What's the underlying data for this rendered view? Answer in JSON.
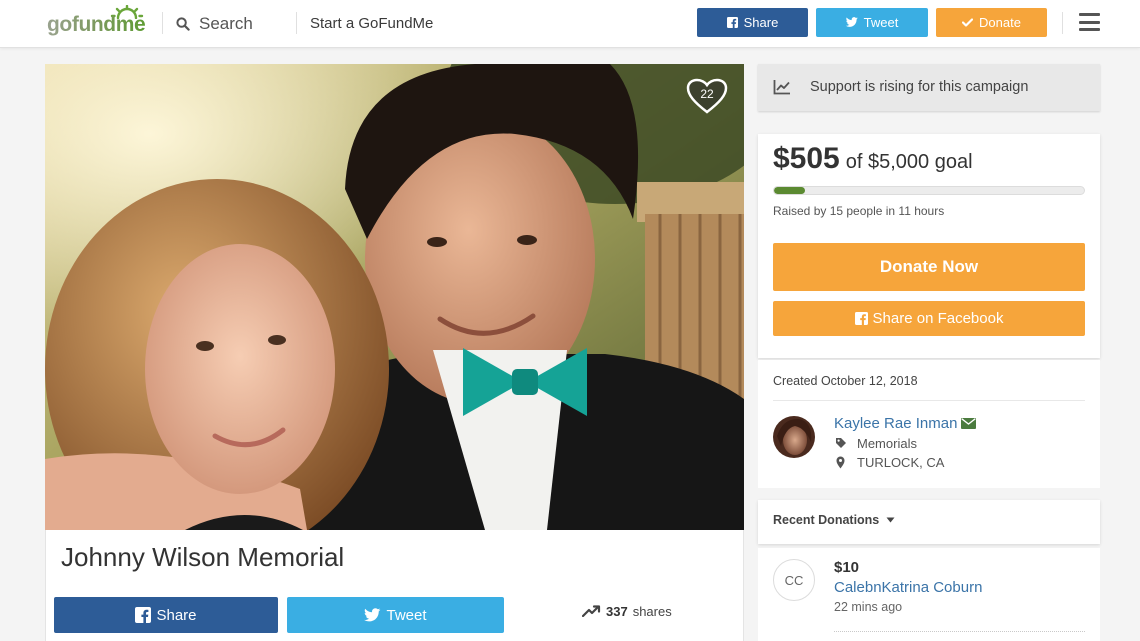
{
  "header": {
    "logo_text": "gofundme",
    "search_label": "Search",
    "start_label": "Start a GoFundMe",
    "share_label": "Share",
    "tweet_label": "Tweet",
    "donate_label": "Donate"
  },
  "campaign": {
    "title": "Johnny Wilson Memorial",
    "hearts": "22",
    "share_label": "Share",
    "tweet_label": "Tweet",
    "shares_count": "337",
    "shares_label": "shares"
  },
  "momentum": {
    "text": "Support is rising for this campaign"
  },
  "progress": {
    "raised": "$505",
    "goal_text": "of $5,000 goal",
    "progress_fraction": 0.101,
    "raised_by": "Raised by 15 people in 11 hours",
    "donate_now_label": "Donate Now",
    "share_facebook_label": "Share on Facebook"
  },
  "organizer": {
    "created": "Created October 12, 2018",
    "name": "Kaylee Rae Inman",
    "category": "Memorials",
    "location": "TURLOCK, CA"
  },
  "donations": {
    "heading": "Recent Donations",
    "items": [
      {
        "initials": "CC",
        "amount": "$10",
        "name": "CalebnKatrina Coburn",
        "time": "22 mins ago"
      }
    ]
  },
  "colors": {
    "facebook": "#2d5c97",
    "twitter": "#3aaee3",
    "donate": "#f6a53b",
    "progress": "#5b8a31",
    "link": "#3b74a8",
    "momentum_bg": "#e8e8e8",
    "logo_green": "#5f9c34"
  },
  "icons": {
    "search": "search-icon",
    "facebook": "facebook-icon",
    "twitter": "twitter-icon",
    "donate": "check-icon",
    "menu": "hamburger-menu-icon",
    "heart": "heart-icon",
    "momentum": "trending-chart-icon",
    "shares": "trending-arrow-icon",
    "contact": "envelope-icon",
    "category": "tag-icon",
    "location": "map-marker-icon",
    "dropdown": "caret-down-icon"
  }
}
